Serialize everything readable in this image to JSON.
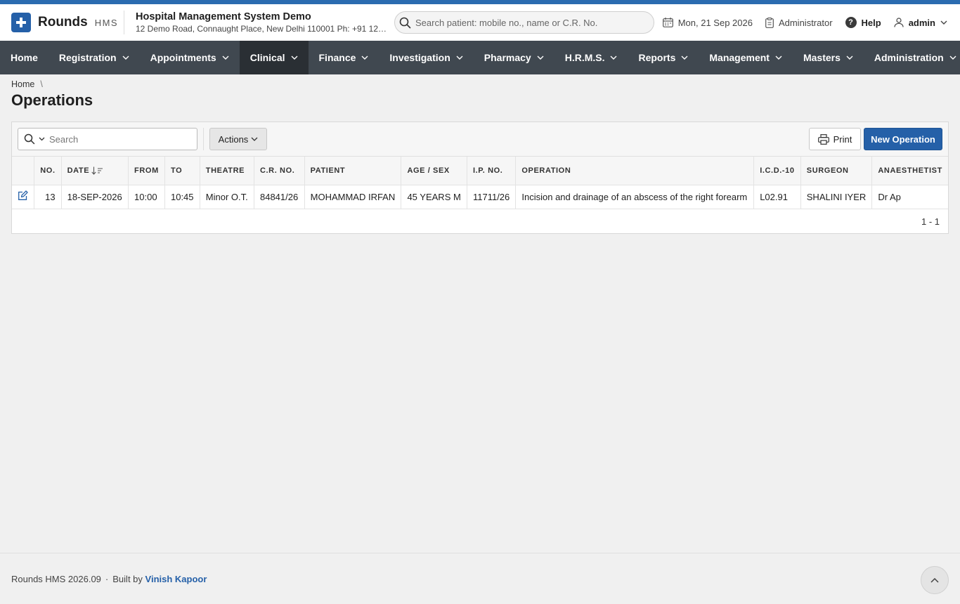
{
  "brand": {
    "name": "Rounds",
    "sub": "HMS",
    "accent_color": "#2560a8"
  },
  "org": {
    "name": "Hospital Management System Demo",
    "address": "12 Demo Road, Connaught Place, New Delhi 110001 Ph: +91 123..."
  },
  "search": {
    "placeholder": "Search patient: mobile no., name or C.R. No."
  },
  "header": {
    "date": "Mon, 21 Sep 2026",
    "role": "Administrator",
    "help": "Help",
    "user": "admin"
  },
  "nav": {
    "items": [
      {
        "label": "Home"
      },
      {
        "label": "Registration"
      },
      {
        "label": "Appointments"
      },
      {
        "label": "Clinical"
      },
      {
        "label": "Finance"
      },
      {
        "label": "Investigation"
      },
      {
        "label": "Pharmacy"
      },
      {
        "label": "H.R.M.S."
      },
      {
        "label": "Reports"
      },
      {
        "label": "Management"
      },
      {
        "label": "Masters"
      },
      {
        "label": "Administration"
      }
    ],
    "active": "Clinical"
  },
  "breadcrumb": {
    "home": "Home",
    "separator": "\\"
  },
  "page": {
    "title": "Operations"
  },
  "toolbar": {
    "search_placeholder": "Search",
    "actions_label": "Actions",
    "print_label": "Print",
    "new_label": "New Operation"
  },
  "table": {
    "columns": [
      "NO.",
      "DATE",
      "FROM",
      "TO",
      "THEATRE",
      "C.R. NO.",
      "PATIENT",
      "AGE / SEX",
      "I.P. NO.",
      "OPERATION",
      "I.C.D.-10",
      "SURGEON",
      "ANAESTHETIST"
    ],
    "rows": [
      {
        "no": "13",
        "date": "18-SEP-2026",
        "from": "10:00",
        "to": "10:45",
        "theatre": "Minor O.T.",
        "cr_no": "84841/26",
        "patient": "MOHAMMAD IRFAN",
        "age_sex": "45 YEARS M",
        "ip_no": "11711/26",
        "operation": "Incision and drainage of an abscess of the right forearm",
        "icd10": "L02.91",
        "surgeon": "SHALINI IYER",
        "anaesthetist": "Dr Ap"
      }
    ],
    "pagination": "1 - 1"
  },
  "footer": {
    "version": "Rounds HMS 2026.09",
    "dot": "·",
    "built_by": "Built by",
    "author": "Vinish Kapoor"
  }
}
